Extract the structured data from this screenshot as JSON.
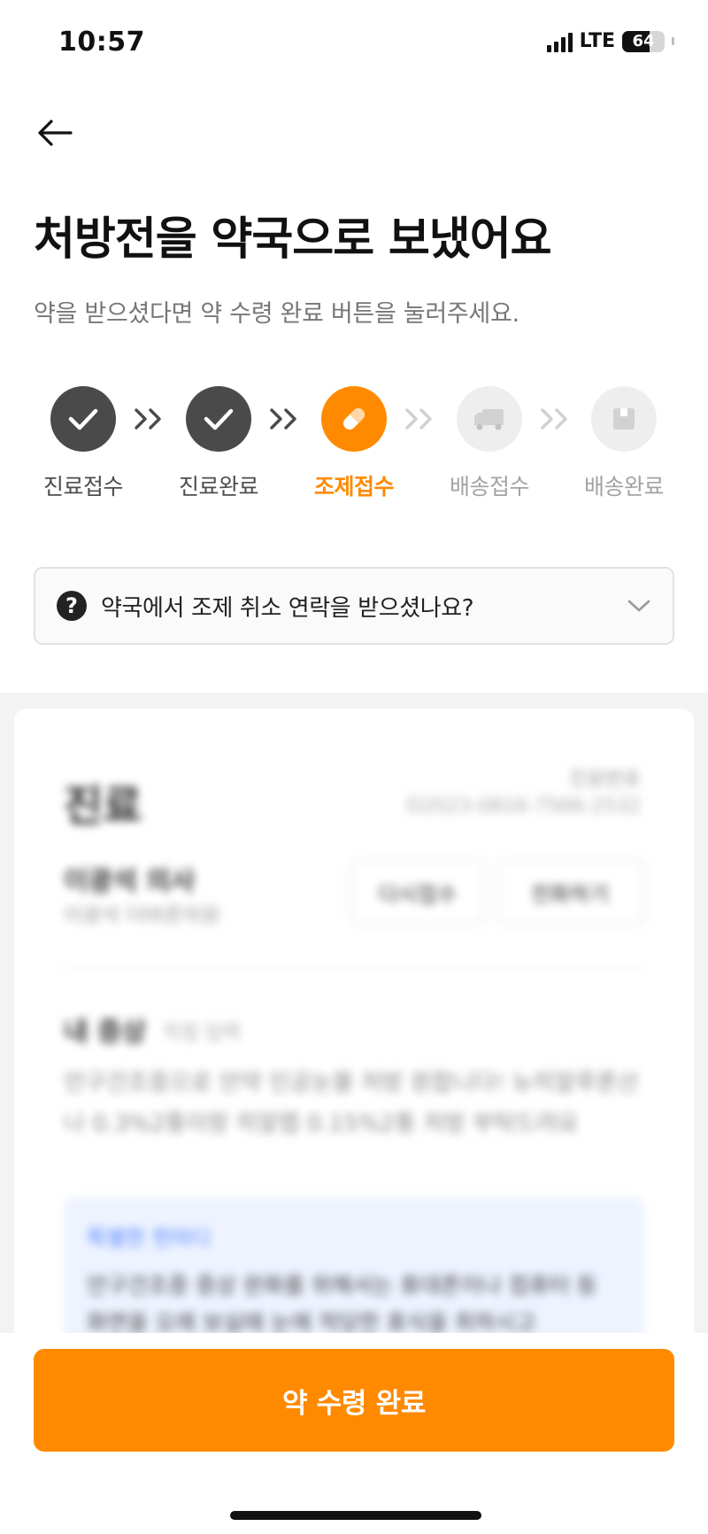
{
  "status_bar": {
    "time": "10:57",
    "network": "LTE",
    "battery": "64",
    "battery_level": 0.64
  },
  "header": {
    "back_icon": "arrow-left-icon"
  },
  "page": {
    "title": "처방전을 약국으로 보냈어요",
    "subtitle": "약을 받으셨다면 약 수령 완료 버튼을 눌러주세요."
  },
  "steps": [
    {
      "label": "진료접수",
      "state": "done",
      "icon": "check-icon"
    },
    {
      "label": "진료완료",
      "state": "done",
      "icon": "check-icon"
    },
    {
      "label": "조제접수",
      "state": "active",
      "icon": "pill-icon"
    },
    {
      "label": "배송접수",
      "state": "pending",
      "icon": "truck-icon"
    },
    {
      "label": "배송완료",
      "state": "pending",
      "icon": "box-icon"
    }
  ],
  "faq": {
    "question": "약국에서 조제 취소 연락을 받으셨나요?",
    "icon": "question-icon"
  },
  "card": {
    "title": "진료",
    "meta_label": "진료번호",
    "meta_value": "D2023-0816-7566-2532",
    "doctor_name": "이광석 의사",
    "doctor_sub": "이광석 더바른의원",
    "button_reapply": "다시접수",
    "button_call": "전화하기",
    "symptom_title": "내 증상",
    "symptom_tag": "직접 입력",
    "symptom_body": "안구건조증으로 안약 인공눈물 처방 원합니다! 뉴히알루론산나 0.3%2통이랑 히알랩 0.15%2통 처방 부탁드려요",
    "special_title": "특별한 한마디",
    "special_body": "안구건조증 증상 완화를 위해서는 휴대폰이나 컴퓨터 등 화면을 오래 보실때 눈에 적당한 휴식을 취하시고"
  },
  "cta": {
    "label": "약 수령 완료"
  },
  "colors": {
    "accent": "#ff8a00",
    "done": "#4a4a4a",
    "pending": "#eeeeee"
  }
}
